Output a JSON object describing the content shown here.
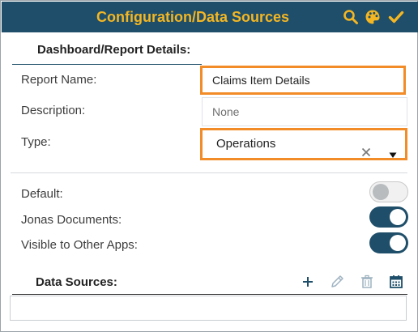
{
  "header": {
    "title": "Configuration/Data Sources",
    "icons": [
      "search-icon",
      "palette-icon",
      "checkmark-icon"
    ],
    "background": "#1e4e69",
    "title_color": "#f4b623"
  },
  "details": {
    "section_title": "Dashboard/Report Details:",
    "report_name_label": "Report Name:",
    "report_name_value": "Claims Item Details",
    "description_label": "Description:",
    "description_placeholder": "None",
    "type_label": "Type:",
    "type_value": "Operations",
    "highlight_color": "#f28c28"
  },
  "toggles": {
    "default_label": "Default:",
    "default_on": false,
    "jonas_label": "Jonas Documents:",
    "jonas_on": true,
    "visible_label": "Visible to Other Apps:",
    "visible_on": true
  },
  "data_sources": {
    "section_title": "Data Sources:",
    "tools": [
      "plus-icon",
      "pencil-icon",
      "trash-icon",
      "calendar-icon"
    ]
  }
}
